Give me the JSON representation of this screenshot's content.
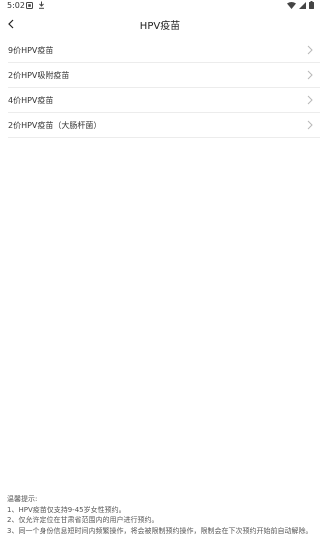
{
  "status_bar": {
    "time": "5:02"
  },
  "header": {
    "title": "HPV疫苗"
  },
  "list": {
    "items": [
      {
        "label": "9价HPV疫苗"
      },
      {
        "label": "2价HPV吸附疫苗"
      },
      {
        "label": "4价HPV疫苗"
      },
      {
        "label": "2价HPV疫苗（大肠杆菌）"
      }
    ]
  },
  "tips": {
    "title": "温馨提示:",
    "lines": [
      "1、HPV疫苗仅支持9-45岁女性预约。",
      "2、仅允许定位在甘肃省范围内的用户进行预约。",
      "3、同一个身份信息短时间内频繁操作，将会被限制预约操作，限制会在下次预约开始前自动解除。"
    ]
  },
  "colors": {
    "divider": "#ececec",
    "chevron": "#b8b8b8",
    "text": "#333333"
  }
}
